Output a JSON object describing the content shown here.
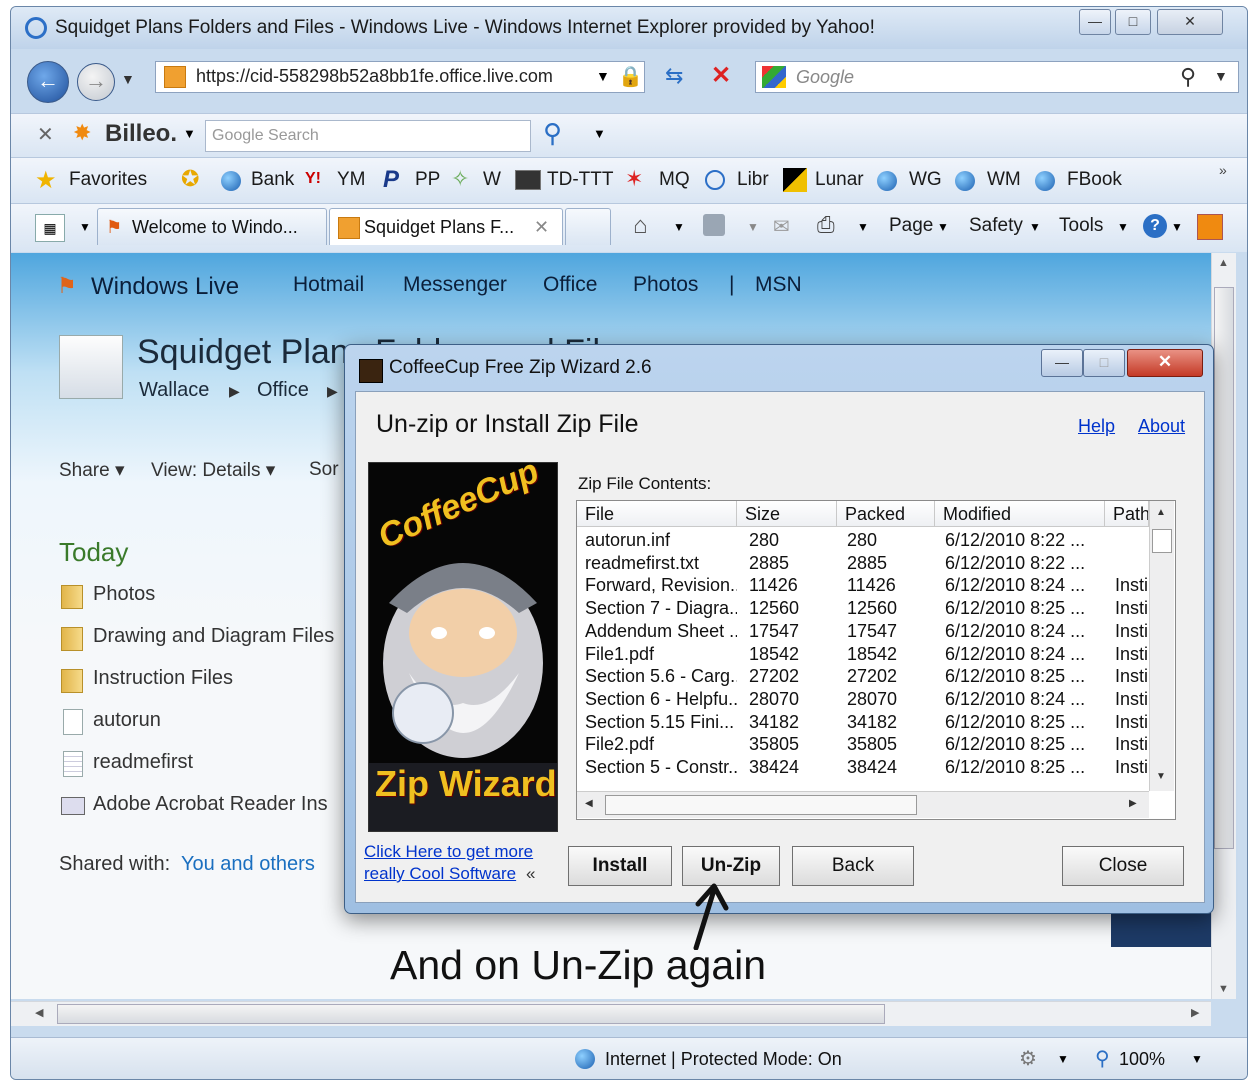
{
  "browser": {
    "title": "Squidget Plans Folders and Files - Windows Live - Windows Internet Explorer provided by Yahoo!",
    "url": "https://cid-558298b52a8bb1fe.office.live.com",
    "search_placeholder": "Google",
    "toolbar_brand": "Billeo.",
    "toolbar_search_placeholder": "Google Search",
    "favorites_label": "Favorites",
    "favorites": [
      "Bank",
      "YM",
      "PP",
      "W",
      "TD-TTT",
      "MQ",
      "Libr",
      "Lunar",
      "WG",
      "WM",
      "FBook"
    ],
    "tabs": [
      "Welcome to Windo...",
      "Squidget Plans F..."
    ],
    "commands": [
      "Page",
      "Safety",
      "Tools"
    ],
    "status": "Internet | Protected Mode: On",
    "zoom": "100%"
  },
  "page": {
    "brand": "Windows Live",
    "nav": [
      "Hotmail",
      "Messenger",
      "Office",
      "Photos",
      "|",
      "MSN"
    ],
    "title": "Squidget Plans Folders and Files",
    "breadcrumb": [
      "Wallace",
      "Office"
    ],
    "toolbar": [
      "Share ▾",
      "View: Details ▾",
      "Sor"
    ],
    "section": "Today",
    "items": [
      {
        "name": "Photos",
        "type": "folder"
      },
      {
        "name": "Drawing and Diagram Files",
        "type": "folder"
      },
      {
        "name": "Instruction Files",
        "type": "folder"
      },
      {
        "name": "autorun",
        "type": "file"
      },
      {
        "name": "readmefirst",
        "type": "text"
      },
      {
        "name": "Adobe Acrobat Reader Ins",
        "type": "app"
      }
    ],
    "shared_prefix": "Shared with:",
    "shared_link": "You and others"
  },
  "dialog": {
    "title": "CoffeeCup Free Zip Wizard 2.6",
    "heading": "Un-zip or Install Zip File",
    "help": "Help",
    "about": "About",
    "image_text_top": "CoffeeCup",
    "image_text_bottom": "Zip Wizard",
    "contents_label": "Zip File Contents:",
    "columns": [
      "File",
      "Size",
      "Packed",
      "Modified",
      "Path"
    ],
    "rows": [
      [
        "autorun.inf",
        "280",
        "280",
        "6/12/2010 8:22 ...",
        ""
      ],
      [
        "readmefirst.txt",
        "2885",
        "2885",
        "6/12/2010 8:22 ...",
        ""
      ],
      [
        "Forward, Revision...",
        "11426",
        "11426",
        "6/12/2010 8:24 ...",
        "Insti"
      ],
      [
        "Section 7 - Diagra...",
        "12560",
        "12560",
        "6/12/2010 8:25 ...",
        "Insti"
      ],
      [
        "Addendum Sheet ...",
        "17547",
        "17547",
        "6/12/2010 8:24 ...",
        "Insti"
      ],
      [
        "File1.pdf",
        "18542",
        "18542",
        "6/12/2010 8:24 ...",
        "Insti"
      ],
      [
        "Section 5.6 - Carg...",
        "27202",
        "27202",
        "6/12/2010 8:25 ...",
        "Insti"
      ],
      [
        "Section 6 - Helpfu...",
        "28070",
        "28070",
        "6/12/2010 8:24 ...",
        "Insti"
      ],
      [
        "Section 5.15 Fini...",
        "34182",
        "34182",
        "6/12/2010 8:25 ...",
        "Insti"
      ],
      [
        "File2.pdf",
        "35805",
        "35805",
        "6/12/2010 8:25 ...",
        "Insti"
      ],
      [
        "Section 5 - Constr...",
        "38424",
        "38424",
        "6/12/2010 8:25 ...",
        "Insti"
      ]
    ],
    "promo_link_1": "Click Here to get more",
    "promo_link_2": "really Cool Software",
    "promo_arrow": "«",
    "buttons": {
      "install": "Install",
      "unzip": "Un-Zip",
      "back": "Back",
      "close": "Close"
    }
  },
  "annotation": "And on Un-Zip again"
}
